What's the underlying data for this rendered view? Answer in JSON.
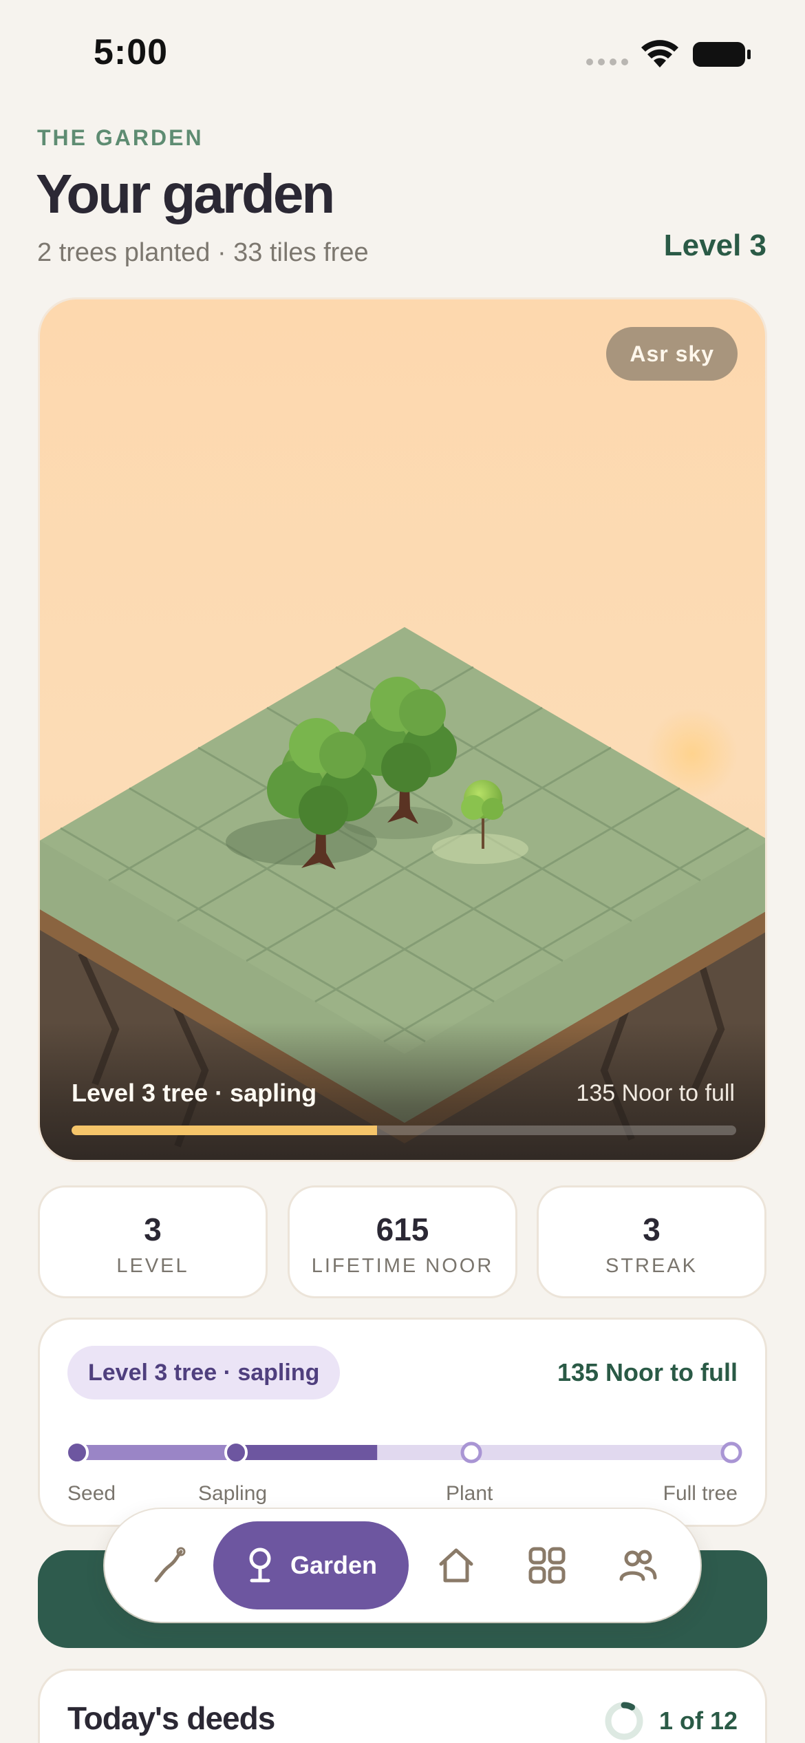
{
  "status_bar": {
    "time": "5:00"
  },
  "header": {
    "eyebrow": "THE GARDEN",
    "title": "Your garden",
    "subtitle": "2 trees planted · 33 tiles free",
    "level": "Level 3"
  },
  "garden_card": {
    "sky_label": "Asr sky",
    "tree_caption": "Level 3 tree · sapling",
    "noor_caption": "135 Noor to full",
    "progress_fraction": 0.46
  },
  "stats": [
    {
      "value": "3",
      "label": "LEVEL"
    },
    {
      "value": "615",
      "label": "LIFETIME NOOR"
    },
    {
      "value": "3",
      "label": "STREAK"
    }
  ],
  "growth": {
    "stage_pill": "Level 3 tree · sapling",
    "noor_to_full": "135 Noor to full",
    "stages": [
      "Seed",
      "Sapling",
      "Plant",
      "Full tree"
    ],
    "current_stage_index": 1,
    "progress_to_next_fraction": 0.6
  },
  "nav": {
    "active_label": "Garden",
    "tabs": [
      {
        "icon": "path-icon"
      },
      {
        "icon": "sprout-icon",
        "label": "Garden"
      },
      {
        "icon": "home-icon"
      },
      {
        "icon": "grid-icon"
      },
      {
        "icon": "people-icon"
      }
    ]
  },
  "deeds": {
    "title": "Today's deeds",
    "count": "1 of 12",
    "done": 1,
    "total": 12
  },
  "colors": {
    "accent_purple": "#6d56a0",
    "accent_green": "#2e5b4d",
    "progress_gold": "#f5c56a",
    "background": "#f6f3ee"
  }
}
